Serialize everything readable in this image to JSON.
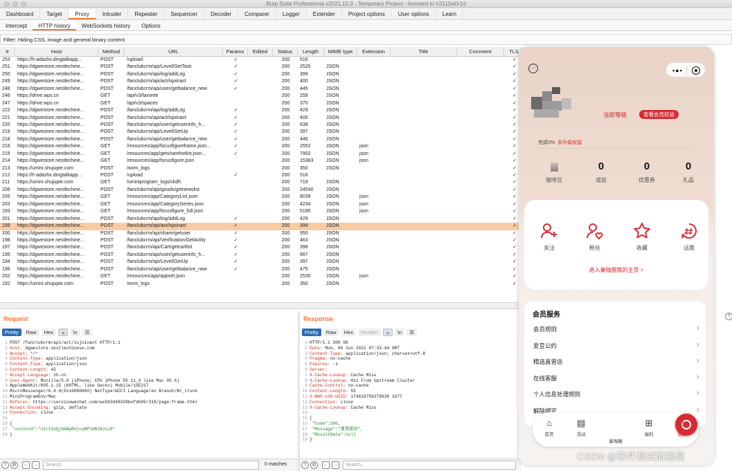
{
  "title": "Burp Suite Professional v2021.10.3 - Temporary Project - licensed to h3110w0r1d",
  "main_tabs": [
    "Dashboard",
    "Target",
    "Proxy",
    "Intruder",
    "Repeater",
    "Sequencer",
    "Decoder",
    "Comparer",
    "Logger",
    "Extender",
    "Project options",
    "User options",
    "Learn"
  ],
  "sub_tabs": [
    "Intercept",
    "HTTP history",
    "WebSockets history",
    "Options"
  ],
  "filter": "Filter: Hiding CSS, image and general binary content",
  "columns": [
    "#",
    "Host",
    "Method",
    "URL",
    "Params",
    "Edited",
    "Status",
    "Length",
    "MIME type",
    "Extension",
    "Title",
    "Comment",
    "TLS"
  ],
  "rows": [
    [
      "253",
      "https://h-adashx.dingtalkapp...",
      "POST",
      "/upload",
      "✓",
      "",
      "200",
      "516",
      "",
      "",
      "",
      "",
      "✓"
    ],
    [
      "251",
      "https://dgwestore.nestlechine...",
      "POST",
      "/fanclubcrm/api/Level/GetTask",
      "✓",
      "",
      "200",
      "2525",
      "JSON",
      "",
      "",
      "",
      "✓"
    ],
    [
      "250",
      "https://dgwestore.nestlechine...",
      "POST",
      "/fanclubcrm/api/log/addLog",
      "✓",
      "",
      "200",
      "399",
      "JSON",
      "",
      "",
      "",
      "✓"
    ],
    [
      "249",
      "https://dgwestore.nestlechine...",
      "POST",
      "/fanclubcrm/api/act/isjoinact",
      "✓",
      "",
      "200",
      "400",
      "JSON",
      "",
      "",
      "",
      "✓"
    ],
    [
      "248",
      "https://dgwestore.nestlechine...",
      "POST",
      "/fanclubcrm/api/user/getbalance_new",
      "✓",
      "",
      "200",
      "445",
      "JSON",
      "",
      "",
      "",
      "✓"
    ],
    [
      "246",
      "https://drive.wps.cn",
      "GET",
      "/api/v3/favorite",
      "",
      "",
      "200",
      "259",
      "JSON",
      "",
      "",
      "",
      "✓"
    ],
    [
      "247",
      "https://drive.wps.cn",
      "GET",
      "/api/v3/spaces",
      "",
      "",
      "200",
      "370",
      "JSON",
      "",
      "",
      "",
      "✓"
    ],
    [
      "222",
      "https://dgwestore.nestlechine...",
      "POST",
      "/fanclubcrm/api/log/addLog",
      "✓",
      "",
      "200",
      "429",
      "JSON",
      "",
      "",
      "",
      "✓"
    ],
    [
      "221",
      "https://dgwestore.nestlechine...",
      "POST",
      "/fanclubcrm/api/act/isjoinact",
      "✓",
      "",
      "200",
      "400",
      "JSON",
      "",
      "",
      "",
      "✓"
    ],
    [
      "220",
      "https://dgwestore.nestlechine...",
      "POST",
      "/fanclubcrm/api/user/getuserinfo_h...",
      "✓",
      "",
      "200",
      "638",
      "JSON",
      "",
      "",
      "",
      "✓"
    ],
    [
      "219",
      "https://dgwestore.nestlechine...",
      "POST",
      "/fanclubcrm/api/Level/GetUp",
      "✓",
      "",
      "200",
      "397",
      "JSON",
      "",
      "",
      "",
      "✓"
    ],
    [
      "218",
      "https://dgwestore.nestlechine...",
      "POST",
      "/fanclubcrm/api/user/getbalance_new",
      "✓",
      "",
      "200",
      "446",
      "JSON",
      "",
      "",
      "",
      "✓"
    ],
    [
      "216",
      "https://dgwestore.nestlechine...",
      "GET",
      "/resources/app/focusfigureframe.json...",
      "✓",
      "",
      "200",
      "2552",
      "JSON",
      "json",
      "",
      "",
      "✓"
    ],
    [
      "215",
      "https://dgwestore.nestlechine...",
      "GET",
      "/resources/app/getsharehotlist.json...",
      "✓",
      "",
      "200",
      "7902",
      "JSON",
      "json",
      "",
      "",
      "✓"
    ],
    [
      "214",
      "https://dgwestore.nestlechine...",
      "GET",
      "/resources/app/focusfigure.json",
      "",
      "",
      "200",
      "15383",
      "JSON",
      "json",
      "",
      "",
      "✓"
    ],
    [
      "213",
      "https://umini.shujupie.com",
      "POST",
      "/wxm_logs",
      "",
      "",
      "200",
      "350",
      "JSON",
      "",
      "",
      "",
      "✓"
    ],
    [
      "212",
      "https://h-adashx.dingtalkapp...",
      "POST",
      "/upload",
      "✓",
      "",
      "200",
      "516",
      "",
      "",
      "",
      "",
      "✓"
    ],
    [
      "211",
      "https://umini.shujupie.com",
      "GET",
      "/uminiprogram_logs/ckdh",
      "",
      "",
      "200",
      "718",
      "JSON",
      "",
      "",
      "",
      "✓"
    ],
    [
      "206",
      "https://dgwestore.nestlechine...",
      "POST",
      "/fanclubcrm/api/goods/getnewslist",
      "",
      "",
      "200",
      "24540",
      "JSON",
      "",
      "",
      "",
      "✓"
    ],
    [
      "205",
      "https://dgwestore.nestlechine...",
      "GET",
      "/resources/app/CategoryList.json",
      "",
      "",
      "200",
      "8039",
      "JSON",
      "json",
      "",
      "",
      "✓"
    ],
    [
      "203",
      "https://dgwestore.nestlechine...",
      "GET",
      "/resources/app/CategorySeries.json",
      "",
      "",
      "200",
      "4234",
      "JSON",
      "json",
      "",
      "",
      "✓"
    ],
    [
      "193",
      "https://dgwestore.nestlechine...",
      "GET",
      "/resources/app/focusfigure_full.json",
      "",
      "",
      "200",
      "5185",
      "JSON",
      "json",
      "",
      "",
      "✓"
    ],
    [
      "201",
      "https://dgwestore.nestlechine...",
      "POST",
      "/fanclubcrm/api/log/addLog",
      "✓",
      "",
      "200",
      "429",
      "JSON",
      "",
      "",
      "",
      "✓"
    ],
    [
      "199",
      "https://dgwestore.nestlechine...",
      "POST",
      "/fanclubcrm/api/act/isjoinact",
      "✓",
      "",
      "200",
      "399",
      "JSON",
      "",
      "",
      "",
      "✓"
    ],
    [
      "200",
      "https://dgwestore.nestlechine...",
      "POST",
      "/fanclubcrm/api/share/getuser",
      "✓",
      "",
      "200",
      "950",
      "JSON",
      "",
      "",
      "",
      "✓"
    ],
    [
      "198",
      "https://dgwestore.nestlechine...",
      "POST",
      "/fanclubcrm/api/Verification/GetActity",
      "✓",
      "",
      "200",
      "463",
      "JSON",
      "",
      "",
      "",
      "✓"
    ],
    [
      "197",
      "https://dgwestore.nestlechine...",
      "POST",
      "/fanclubcrm/api/Cart/getcartlist",
      "✓",
      "",
      "200",
      "398",
      "JSON",
      "",
      "",
      "",
      "✓"
    ],
    [
      "195",
      "https://dgwestore.nestlechine...",
      "POST",
      "/fanclubcrm/api/user/getuserinfo_h...",
      "✓",
      "",
      "200",
      "667",
      "JSON",
      "",
      "",
      "",
      "✓"
    ],
    [
      "194",
      "https://dgwestore.nestlechine...",
      "POST",
      "/fanclubcrm/api/Level/GetUp",
      "✓",
      "",
      "200",
      "397",
      "JSON",
      "",
      "",
      "",
      "✓"
    ],
    [
      "196",
      "https://dgwestore.nestlechine...",
      "POST",
      "/fanclubcrm/api/user/getbalance_new",
      "✓",
      "",
      "200",
      "475",
      "JSON",
      "",
      "",
      "",
      "✓"
    ],
    [
      "202",
      "https://dgwestore.nestlechine...",
      "GET",
      "/resources/app/appset.json",
      "",
      "",
      "200",
      "2530",
      "JSON",
      "json",
      "",
      "",
      "✓"
    ],
    [
      "192",
      "https://umini.shujupie.com",
      "POST",
      "/wxm_logs",
      "",
      "",
      "200",
      "350",
      "JSON",
      "",
      "",
      "",
      "✓"
    ]
  ],
  "selected_row": 23,
  "request": {
    "title": "Request",
    "buttons": [
      "Pretty",
      "Raw",
      "Hex",
      "\\n"
    ],
    "lines": [
      [
        "",
        "POST /fanclubcrm/api/act/isjoinact HTTP/1.1"
      ],
      [
        "Host: ",
        "dgwestore.nestlechinese.com"
      ],
      [
        "Accept: ",
        "*/*"
      ],
      [
        "Content-Type: ",
        "application/json"
      ],
      [
        "Content-Type: ",
        "application/json"
      ],
      [
        "Content-Length: ",
        "42"
      ],
      [
        "Accept-Language: ",
        "zh-cn"
      ],
      [
        "User-Agent: ",
        "Mozilla/5.0 (iPhone; CPU iPhone OS 11_3 like Mac OS X)"
      ],
      [
        "",
        "AppleWebKit/605.1.15 (KHTML, like Gecko) Mobile/15E217"
      ],
      [
        "",
        "MicroMessenger/6.8.0(0x16080000) NetType/WIFI Language/en Branch/Br_trunk"
      ],
      [
        "",
        "MiniProgramEnv/Mac"
      ],
      [
        "Referer: ",
        "https://servicewechat.com/wx693d49328befd699/318/page-frame.html"
      ],
      [
        "Accept-Encoding: ",
        "gzip, deflate"
      ],
      [
        "Connection: ",
        "close"
      ],
      [
        "",
        ""
      ],
      [
        "",
        "{"
      ],
      [
        "",
        "  \"unionid\":\"oIrId1Qj6mApRdjcqNPlmNlNJsL8\""
      ],
      [
        "",
        "}"
      ]
    ],
    "search_placeholder": "Search...",
    "matches": "0 matches"
  },
  "response": {
    "title": "Response",
    "buttons": [
      "Pretty",
      "Raw",
      "Hex",
      "Render",
      "\\n"
    ],
    "lines": [
      [
        "",
        "HTTP/1.1 200 OK"
      ],
      [
        "Date: ",
        "Mon, 06 Jun 2022 07:33:44 GMT"
      ],
      [
        "Content-Type: ",
        "application/json; charset=utf-8"
      ],
      [
        "Pragma: ",
        "no-cache"
      ],
      [
        "Expires: ",
        "-1"
      ],
      [
        "Server: ",
        ""
      ],
      [
        "X-Cache-Lookup: ",
        "Cache Miss"
      ],
      [
        "X-Cache-Lookup: ",
        "Hit From Upstream Cluster"
      ],
      [
        "Cache-Control: ",
        "no-cache"
      ],
      [
        "Content-Length: ",
        "55"
      ],
      [
        "X-NWS-LOG-UUID: ",
        "174818750279638 1677"
      ],
      [
        "Connection: ",
        "close"
      ],
      [
        "X-Cache-Lookup: ",
        "Cache Miss"
      ],
      [
        "",
        ""
      ],
      [
        "",
        "{"
      ],
      [
        "",
        "  \"Code\":200,"
      ],
      [
        "",
        "  \"Message\":\"请求成功\","
      ],
      [
        "",
        "  \"ResultData\":null"
      ],
      [
        "",
        "}"
      ]
    ],
    "search_placeholder": "Search...",
    "matches": "0 matches"
  },
  "phone": {
    "level_link": "当前等级",
    "vip_button": "查看会员权益",
    "progress_label": "完成0%",
    "progress_link": "去升级权益",
    "progress_fraction": 0.0,
    "stats": [
      {
        "value": "",
        "label": "咖啡豆"
      },
      {
        "value": "0",
        "label": "成就"
      },
      {
        "value": "0",
        "label": "优惠券"
      },
      {
        "value": "0",
        "label": "礼品"
      }
    ],
    "actions": [
      {
        "label": "关注",
        "icon": "follow-icon"
      },
      {
        "label": "粉丝",
        "icon": "fans-icon"
      },
      {
        "label": "收藏",
        "icon": "star-icon"
      },
      {
        "label": "话题",
        "icon": "topic-icon"
      }
    ],
    "home_link": "进入巢咖圈我的主页 >",
    "services_title": "会员服务",
    "services": [
      "会员规则",
      "爱豆公约",
      "精选直营店",
      "在线客服",
      "个人信息处理规则",
      "解除绑定"
    ],
    "tabs": [
      "首页",
      "活动",
      "巢咖圈",
      "福利",
      "我的"
    ],
    "accent": "#d82a33"
  },
  "watermark": "CSDN @软件测试情报局",
  "right_matches": "0 matches"
}
